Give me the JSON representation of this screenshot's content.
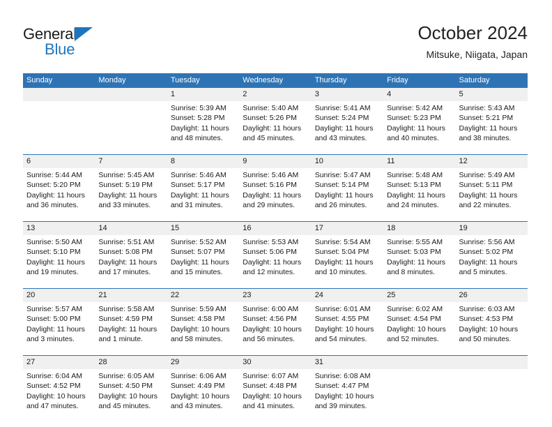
{
  "brand": {
    "name_primary": "General",
    "name_secondary": "Blue",
    "logo_icon": "blue-triangle-icon",
    "accent_color": "#1d75bd"
  },
  "header": {
    "title": "October 2024",
    "subtitle": "Mitsuke, Niigata, Japan",
    "header_bg_color": "#2e74b5",
    "date_band_color": "#f0f0f0"
  },
  "weekdays": [
    "Sunday",
    "Monday",
    "Tuesday",
    "Wednesday",
    "Thursday",
    "Friday",
    "Saturday"
  ],
  "labels": {
    "sunrise_prefix": "Sunrise:",
    "sunset_prefix": "Sunset:",
    "daylight_prefix": "Daylight:"
  },
  "weeks": [
    {
      "days": [
        {
          "date": "",
          "sunrise": "",
          "sunset": "",
          "daylight": "",
          "empty": true
        },
        {
          "date": "",
          "sunrise": "",
          "sunset": "",
          "daylight": "",
          "empty": true
        },
        {
          "date": "1",
          "sunrise": "Sunrise: 5:39 AM",
          "sunset": "Sunset: 5:28 PM",
          "daylight": "Daylight: 11 hours and 48 minutes."
        },
        {
          "date": "2",
          "sunrise": "Sunrise: 5:40 AM",
          "sunset": "Sunset: 5:26 PM",
          "daylight": "Daylight: 11 hours and 45 minutes."
        },
        {
          "date": "3",
          "sunrise": "Sunrise: 5:41 AM",
          "sunset": "Sunset: 5:24 PM",
          "daylight": "Daylight: 11 hours and 43 minutes."
        },
        {
          "date": "4",
          "sunrise": "Sunrise: 5:42 AM",
          "sunset": "Sunset: 5:23 PM",
          "daylight": "Daylight: 11 hours and 40 minutes."
        },
        {
          "date": "5",
          "sunrise": "Sunrise: 5:43 AM",
          "sunset": "Sunset: 5:21 PM",
          "daylight": "Daylight: 11 hours and 38 minutes."
        }
      ]
    },
    {
      "days": [
        {
          "date": "6",
          "sunrise": "Sunrise: 5:44 AM",
          "sunset": "Sunset: 5:20 PM",
          "daylight": "Daylight: 11 hours and 36 minutes."
        },
        {
          "date": "7",
          "sunrise": "Sunrise: 5:45 AM",
          "sunset": "Sunset: 5:19 PM",
          "daylight": "Daylight: 11 hours and 33 minutes."
        },
        {
          "date": "8",
          "sunrise": "Sunrise: 5:46 AM",
          "sunset": "Sunset: 5:17 PM",
          "daylight": "Daylight: 11 hours and 31 minutes."
        },
        {
          "date": "9",
          "sunrise": "Sunrise: 5:46 AM",
          "sunset": "Sunset: 5:16 PM",
          "daylight": "Daylight: 11 hours and 29 minutes."
        },
        {
          "date": "10",
          "sunrise": "Sunrise: 5:47 AM",
          "sunset": "Sunset: 5:14 PM",
          "daylight": "Daylight: 11 hours and 26 minutes."
        },
        {
          "date": "11",
          "sunrise": "Sunrise: 5:48 AM",
          "sunset": "Sunset: 5:13 PM",
          "daylight": "Daylight: 11 hours and 24 minutes."
        },
        {
          "date": "12",
          "sunrise": "Sunrise: 5:49 AM",
          "sunset": "Sunset: 5:11 PM",
          "daylight": "Daylight: 11 hours and 22 minutes."
        }
      ]
    },
    {
      "days": [
        {
          "date": "13",
          "sunrise": "Sunrise: 5:50 AM",
          "sunset": "Sunset: 5:10 PM",
          "daylight": "Daylight: 11 hours and 19 minutes."
        },
        {
          "date": "14",
          "sunrise": "Sunrise: 5:51 AM",
          "sunset": "Sunset: 5:08 PM",
          "daylight": "Daylight: 11 hours and 17 minutes."
        },
        {
          "date": "15",
          "sunrise": "Sunrise: 5:52 AM",
          "sunset": "Sunset: 5:07 PM",
          "daylight": "Daylight: 11 hours and 15 minutes."
        },
        {
          "date": "16",
          "sunrise": "Sunrise: 5:53 AM",
          "sunset": "Sunset: 5:06 PM",
          "daylight": "Daylight: 11 hours and 12 minutes."
        },
        {
          "date": "17",
          "sunrise": "Sunrise: 5:54 AM",
          "sunset": "Sunset: 5:04 PM",
          "daylight": "Daylight: 11 hours and 10 minutes."
        },
        {
          "date": "18",
          "sunrise": "Sunrise: 5:55 AM",
          "sunset": "Sunset: 5:03 PM",
          "daylight": "Daylight: 11 hours and 8 minutes."
        },
        {
          "date": "19",
          "sunrise": "Sunrise: 5:56 AM",
          "sunset": "Sunset: 5:02 PM",
          "daylight": "Daylight: 11 hours and 5 minutes."
        }
      ]
    },
    {
      "days": [
        {
          "date": "20",
          "sunrise": "Sunrise: 5:57 AM",
          "sunset": "Sunset: 5:00 PM",
          "daylight": "Daylight: 11 hours and 3 minutes."
        },
        {
          "date": "21",
          "sunrise": "Sunrise: 5:58 AM",
          "sunset": "Sunset: 4:59 PM",
          "daylight": "Daylight: 11 hours and 1 minute."
        },
        {
          "date": "22",
          "sunrise": "Sunrise: 5:59 AM",
          "sunset": "Sunset: 4:58 PM",
          "daylight": "Daylight: 10 hours and 58 minutes."
        },
        {
          "date": "23",
          "sunrise": "Sunrise: 6:00 AM",
          "sunset": "Sunset: 4:56 PM",
          "daylight": "Daylight: 10 hours and 56 minutes."
        },
        {
          "date": "24",
          "sunrise": "Sunrise: 6:01 AM",
          "sunset": "Sunset: 4:55 PM",
          "daylight": "Daylight: 10 hours and 54 minutes."
        },
        {
          "date": "25",
          "sunrise": "Sunrise: 6:02 AM",
          "sunset": "Sunset: 4:54 PM",
          "daylight": "Daylight: 10 hours and 52 minutes."
        },
        {
          "date": "26",
          "sunrise": "Sunrise: 6:03 AM",
          "sunset": "Sunset: 4:53 PM",
          "daylight": "Daylight: 10 hours and 50 minutes."
        }
      ]
    },
    {
      "days": [
        {
          "date": "27",
          "sunrise": "Sunrise: 6:04 AM",
          "sunset": "Sunset: 4:52 PM",
          "daylight": "Daylight: 10 hours and 47 minutes."
        },
        {
          "date": "28",
          "sunrise": "Sunrise: 6:05 AM",
          "sunset": "Sunset: 4:50 PM",
          "daylight": "Daylight: 10 hours and 45 minutes."
        },
        {
          "date": "29",
          "sunrise": "Sunrise: 6:06 AM",
          "sunset": "Sunset: 4:49 PM",
          "daylight": "Daylight: 10 hours and 43 minutes."
        },
        {
          "date": "30",
          "sunrise": "Sunrise: 6:07 AM",
          "sunset": "Sunset: 4:48 PM",
          "daylight": "Daylight: 10 hours and 41 minutes."
        },
        {
          "date": "31",
          "sunrise": "Sunrise: 6:08 AM",
          "sunset": "Sunset: 4:47 PM",
          "daylight": "Daylight: 10 hours and 39 minutes."
        },
        {
          "date": "",
          "sunrise": "",
          "sunset": "",
          "daylight": "",
          "empty": true
        },
        {
          "date": "",
          "sunrise": "",
          "sunset": "",
          "daylight": "",
          "empty": true
        }
      ]
    }
  ]
}
